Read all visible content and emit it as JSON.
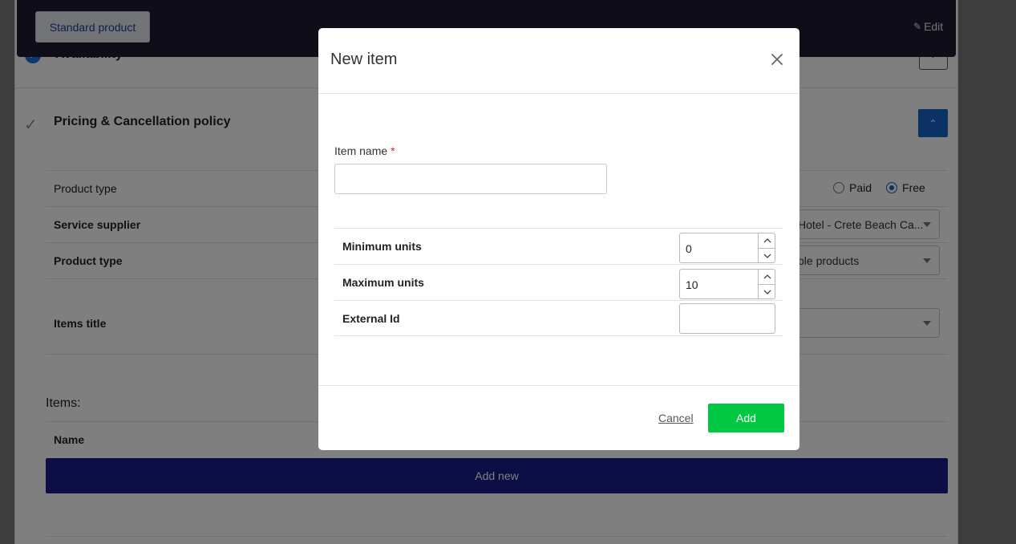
{
  "topbar": {
    "standard_label": "Standard product",
    "edit_label": "Edit"
  },
  "availability": {
    "label": "Availability"
  },
  "pricing": {
    "title": "Pricing & Cancellation policy"
  },
  "rows": {
    "product_type_label": "Product type",
    "radio_paid": "Paid",
    "radio_free": "Free",
    "service_supplier_label": "Service supplier",
    "service_supplier_value": "Hotel - Crete Beach Ca...",
    "product_type2_label": "Product type",
    "product_type2_value": "ble products",
    "items_title_label": "Items title",
    "items_title_value": ""
  },
  "items": {
    "heading": "Items:",
    "name_header": "Name",
    "add_new_label": "Add new"
  },
  "modal": {
    "title": "New item",
    "item_name_label": "Item name",
    "required_mark": "*",
    "item_name_value": "",
    "min_units_label": "Minimum units",
    "min_units_value": "0",
    "max_units_label": "Maximum units",
    "max_units_value": "10",
    "external_id_label": "External Id",
    "external_id_value": "",
    "cancel_label": "Cancel",
    "add_label": "Add"
  },
  "colors": {
    "primary": "#1565c8",
    "add_button": "#00c843",
    "dark_bar": "#1c1a30",
    "add_new_bar": "#1a1d8c"
  }
}
